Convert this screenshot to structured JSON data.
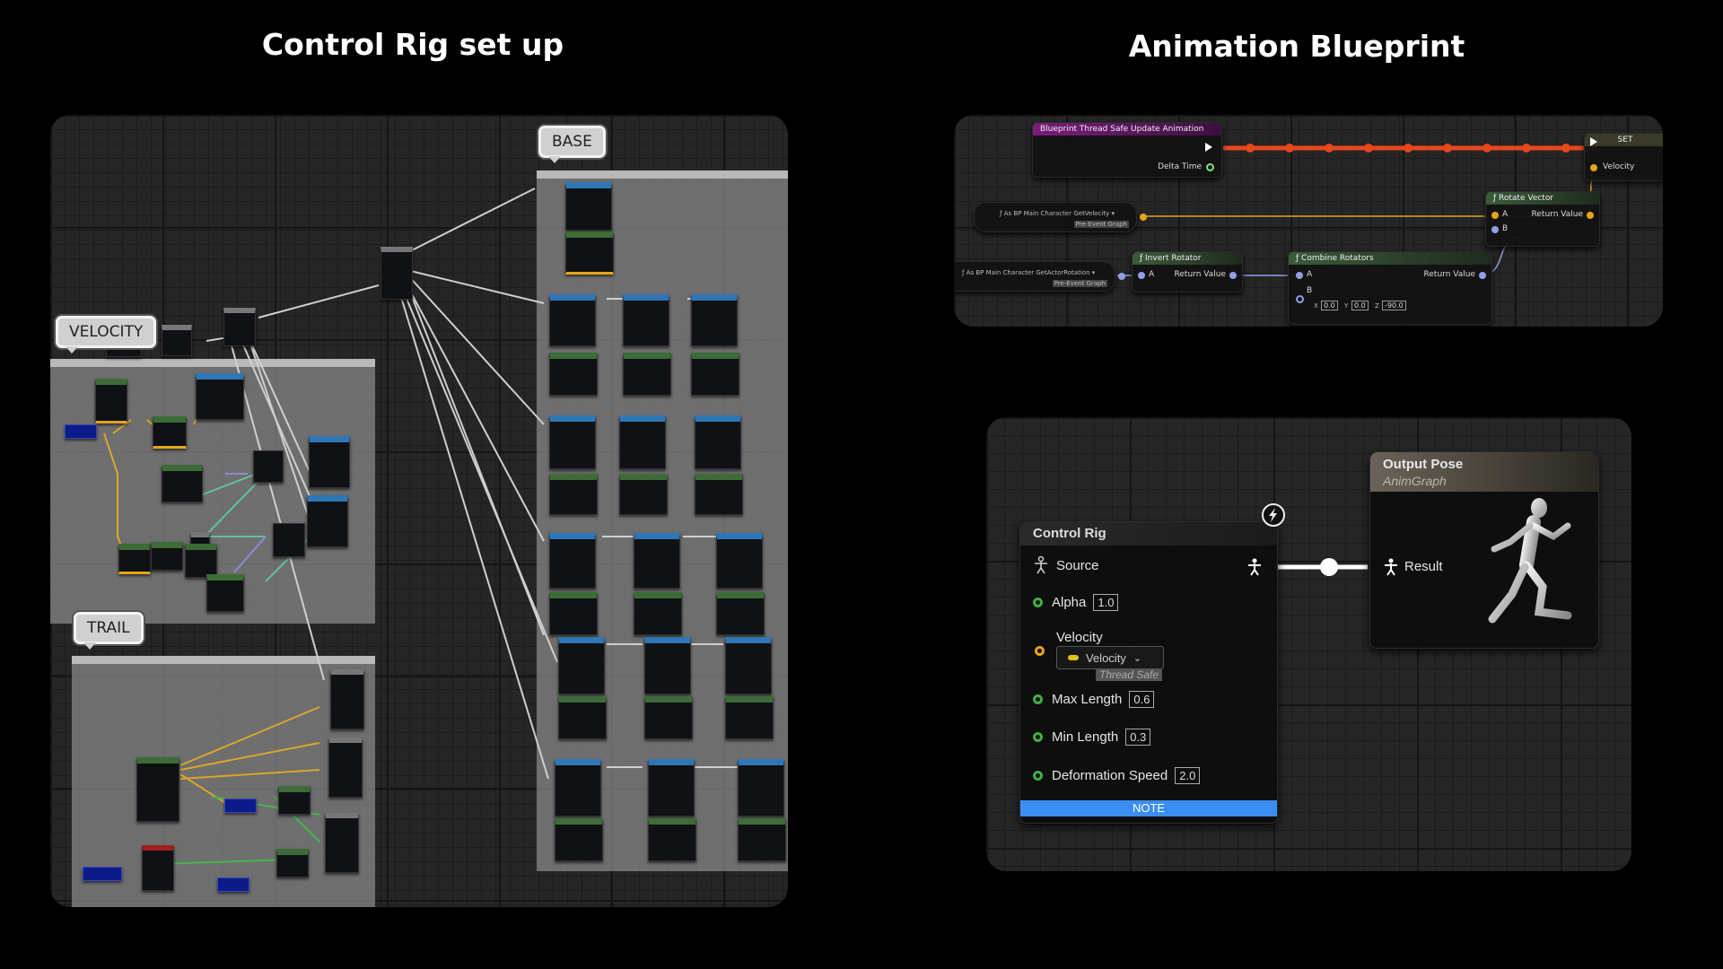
{
  "titles": {
    "left": "Control Rig set up",
    "right": "Animation Blueprint"
  },
  "control_rig_setup": {
    "comment_tags": {
      "velocity": "VELOCITY",
      "trail": "TRAIL",
      "base": "BASE"
    }
  },
  "blueprint_graph": {
    "event_node": {
      "title": "Blueprint Thread Safe Update Animation",
      "pin_delta_time": "Delta Time"
    },
    "set_node": {
      "title": "SET",
      "pin_velocity": "Velocity"
    },
    "get_velocity_node": {
      "title": "As BP Main Character GetVelocity",
      "tag": "Pre-Event Graph"
    },
    "get_rotation_node": {
      "title": "As BP Main Character GetActorRotation",
      "tag": "Pre-Event Graph"
    },
    "invert_rotator": {
      "title": "Invert Rotator",
      "pin_a": "A",
      "pin_return": "Return Value"
    },
    "combine_rotators": {
      "title": "Combine Rotators",
      "pin_a": "A",
      "pin_b": "B",
      "pin_return": "Return Value",
      "b_x_label": "X",
      "b_x": "0.0",
      "b_y_label": "Y",
      "b_y": "0.0",
      "b_z_label": "Z",
      "b_z": "-90.0"
    },
    "rotate_vector": {
      "title": "Rotate Vector",
      "pin_a": "A",
      "pin_b": "B",
      "pin_return": "Return Value"
    },
    "colors": {
      "exec_wire": "#e8471b",
      "event_header": "#7a1e7a",
      "pure_header": "#3b5b3b"
    }
  },
  "anim_graph": {
    "control_rig_node": {
      "title": "Control Rig",
      "source_label": "Source",
      "alpha_label": "Alpha",
      "alpha_value": "1.0",
      "velocity_label": "Velocity",
      "velocity_dropdown": "Velocity",
      "thread_safe_tag": "Thread Safe",
      "max_length_label": "Max Length",
      "max_length_value": "0.6",
      "min_length_label": "Min Length",
      "min_length_value": "0.3",
      "deformation_speed_label": "Deformation Speed",
      "deformation_speed_value": "2.0",
      "note_label": "NOTE",
      "note_color": "#3b8ef0"
    },
    "output_pose_node": {
      "title": "Output Pose",
      "subtitle": "AnimGraph",
      "result_label": "Result"
    }
  }
}
